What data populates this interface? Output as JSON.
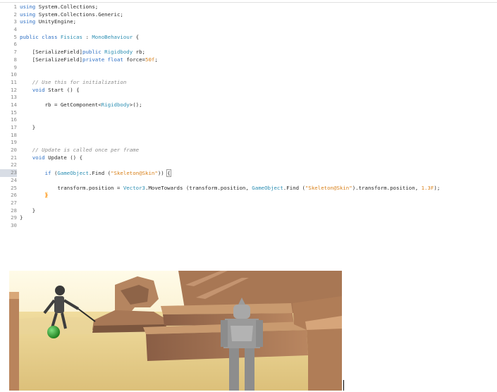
{
  "editor": {
    "lines": [
      {
        "n": "1",
        "tokens": [
          {
            "t": "kw",
            "v": "using"
          },
          {
            "t": "txt",
            "v": " System.Collections;"
          }
        ]
      },
      {
        "n": "2",
        "tokens": [
          {
            "t": "kw",
            "v": "using"
          },
          {
            "t": "txt",
            "v": " System.Collections.Generic;"
          }
        ]
      },
      {
        "n": "3",
        "tokens": [
          {
            "t": "kw",
            "v": "using"
          },
          {
            "t": "txt",
            "v": " UnityEngine;"
          }
        ]
      },
      {
        "n": "4",
        "tokens": []
      },
      {
        "n": "5",
        "tokens": [
          {
            "t": "kw",
            "v": "public class"
          },
          {
            "t": "txt",
            "v": " "
          },
          {
            "t": "type",
            "v": "Fisicas"
          },
          {
            "t": "txt",
            "v": " : "
          },
          {
            "t": "type",
            "v": "MonoBehaviour"
          },
          {
            "t": "txt",
            "v": " {"
          }
        ]
      },
      {
        "n": "6",
        "tokens": []
      },
      {
        "n": "7",
        "tokens": [
          {
            "t": "txt",
            "v": "    [SerializeField]"
          },
          {
            "t": "kw",
            "v": "public"
          },
          {
            "t": "txt",
            "v": " "
          },
          {
            "t": "type",
            "v": "Rigidbody"
          },
          {
            "t": "txt",
            "v": " rb;"
          }
        ]
      },
      {
        "n": "8",
        "tokens": [
          {
            "t": "txt",
            "v": "    [SerializeField]"
          },
          {
            "t": "kw",
            "v": "private float"
          },
          {
            "t": "txt",
            "v": " force="
          },
          {
            "t": "num",
            "v": "50f"
          },
          {
            "t": "txt",
            "v": ";"
          }
        ]
      },
      {
        "n": "9",
        "tokens": []
      },
      {
        "n": "10",
        "tokens": []
      },
      {
        "n": "11",
        "tokens": [
          {
            "t": "com",
            "v": "    // Use this for initialization"
          }
        ]
      },
      {
        "n": "12",
        "tokens": [
          {
            "t": "txt",
            "v": "    "
          },
          {
            "t": "kw",
            "v": "void"
          },
          {
            "t": "txt",
            "v": " Start () {"
          }
        ]
      },
      {
        "n": "13",
        "tokens": []
      },
      {
        "n": "14",
        "tokens": [
          {
            "t": "txt",
            "v": "        rb = GetComponent<"
          },
          {
            "t": "type",
            "v": "Rigidbody"
          },
          {
            "t": "txt",
            "v": ">();"
          }
        ]
      },
      {
        "n": "15",
        "tokens": []
      },
      {
        "n": "16",
        "tokens": []
      },
      {
        "n": "17",
        "tokens": [
          {
            "t": "txt",
            "v": "    }"
          }
        ]
      },
      {
        "n": "18",
        "tokens": []
      },
      {
        "n": "19",
        "tokens": []
      },
      {
        "n": "20",
        "tokens": [
          {
            "t": "com",
            "v": "    // Update is called once per frame"
          }
        ]
      },
      {
        "n": "21",
        "tokens": [
          {
            "t": "txt",
            "v": "    "
          },
          {
            "t": "kw",
            "v": "void"
          },
          {
            "t": "txt",
            "v": " Update () {"
          }
        ]
      },
      {
        "n": "22",
        "tokens": []
      },
      {
        "n": "23",
        "tokens": [
          {
            "t": "txt",
            "v": "        "
          },
          {
            "t": "kw",
            "v": "if"
          },
          {
            "t": "txt",
            "v": " ("
          },
          {
            "t": "type",
            "v": "GameObject"
          },
          {
            "t": "txt",
            "v": ".Find ("
          },
          {
            "t": "str",
            "v": "\"Skeleton@Skin\""
          },
          {
            "t": "txt",
            "v": ")) "
          },
          {
            "t": "brace-open",
            "v": "{"
          },
          {
            "t": "caret",
            "v": ""
          }
        ]
      },
      {
        "n": "24",
        "tokens": []
      },
      {
        "n": "25",
        "tokens": [
          {
            "t": "txt",
            "v": "            transform.position = "
          },
          {
            "t": "type",
            "v": "Vector3"
          },
          {
            "t": "txt",
            "v": ".MoveTowards (transform.position, "
          },
          {
            "t": "type",
            "v": "GameObject"
          },
          {
            "t": "txt",
            "v": ".Find ("
          },
          {
            "t": "str",
            "v": "\"Skeleton@Skin\""
          },
          {
            "t": "txt",
            "v": ").transform.position, "
          },
          {
            "t": "num",
            "v": "1.3F"
          },
          {
            "t": "txt",
            "v": ");"
          }
        ]
      },
      {
        "n": "26",
        "tokens": [
          {
            "t": "txt",
            "v": "        "
          },
          {
            "t": "brace-hl",
            "v": "}"
          }
        ]
      },
      {
        "n": "27",
        "tokens": []
      },
      {
        "n": "28",
        "tokens": [
          {
            "t": "txt",
            "v": "    }"
          }
        ]
      },
      {
        "n": "29",
        "tokens": [
          {
            "t": "txt",
            "v": "}"
          }
        ]
      },
      {
        "n": "30",
        "tokens": []
      }
    ],
    "highlighted_line": "23"
  },
  "game_view": {
    "objects": [
      "skeleton-character",
      "green-ball",
      "sphinx-statue",
      "stepped-pyramid",
      "armored-knight"
    ]
  },
  "colors": {
    "keyword": "#2d6fc4",
    "type": "#2d8fb3",
    "string": "#d9821c",
    "comment": "#8d8d8d",
    "sand": "#e6cf8c",
    "sky": "#fff7e0",
    "brick": "#9b6a4a",
    "ball": "#2aa02a"
  }
}
